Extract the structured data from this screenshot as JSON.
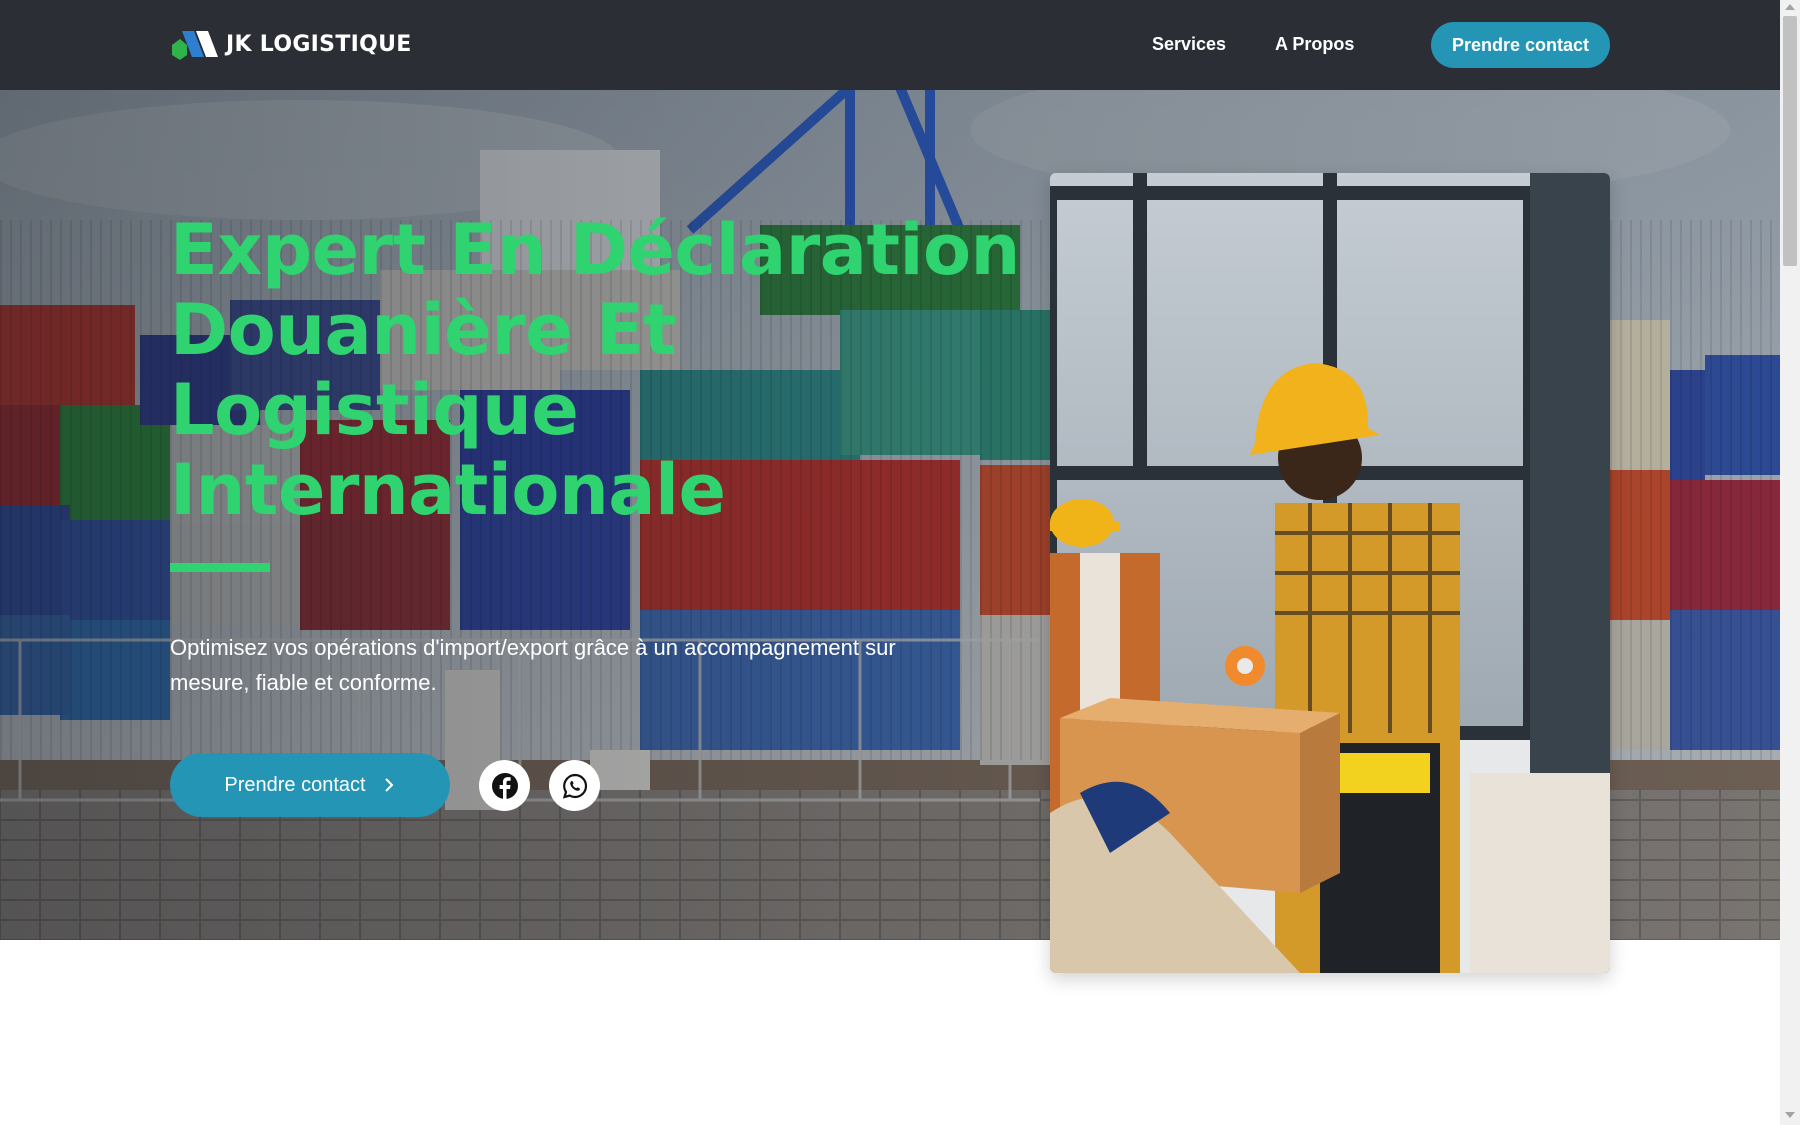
{
  "nav": {
    "logo_text": "JK LOGISTIQUE",
    "links": [
      {
        "label": "Services"
      },
      {
        "label": "A Propos"
      }
    ],
    "cta_label": "Prendre contact"
  },
  "hero": {
    "title_lines": [
      "Expert En Déclaration",
      "Douanière Et",
      "Logistique",
      "Internationale"
    ],
    "subtitle_lines": [
      "Optimisez vos opérations d'import/export grâce à un accompagnement sur",
      "mesure, fiable et conforme."
    ],
    "cta_label": "Prendre contact",
    "cta_icon": "chevron-right-icon",
    "social": [
      {
        "network": "facebook",
        "icon": "facebook-icon"
      },
      {
        "network": "whatsapp",
        "icon": "whatsapp-icon"
      }
    ]
  },
  "colors": {
    "navbar_bg": "#2b2f35",
    "accent_blue": "#2595b6",
    "accent_green": "#2fd36f",
    "text_white": "#ffffff"
  },
  "images": {
    "hero_background": "shipping-containers-port-with-crane",
    "photo_card": "warehouse-workers-packing-boxes"
  }
}
